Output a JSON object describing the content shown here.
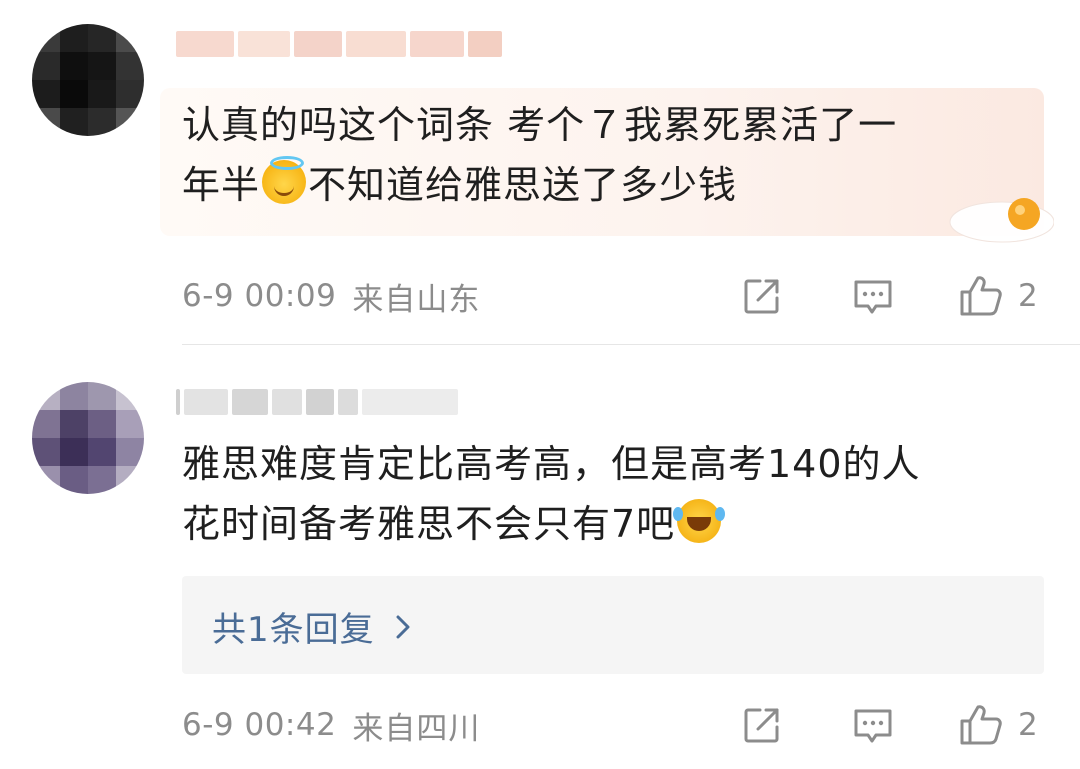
{
  "comments": [
    {
      "text_line1": "认真的吗这个词条 考个７我累死累活了一",
      "text_line2a": "年半",
      "emoji": "smiling-face-with-halo",
      "text_line2b": "不知道给雅思送了多少钱",
      "time": "6-9 00:09",
      "location": "来自山东",
      "likes": "2"
    },
    {
      "text_line1": "雅思难度肯定比高考高，但是高考140的人",
      "text_line2": "花时间备考雅思不会只有7吧",
      "emoji": "rolling-on-floor-laughing",
      "reply_label": "共1条回复",
      "time": "6-9 00:42",
      "location": "来自四川",
      "likes": "2"
    }
  ],
  "colors": {
    "text": "#1f1f1f",
    "meta": "#8c8c8c",
    "reply_link": "#4a6c96",
    "reply_bg": "#f5f5f5",
    "highlight_bg": "#fdf3ee"
  },
  "icons": {
    "share": "share-icon",
    "comment": "comment-icon",
    "like": "thumbs-up-icon",
    "reply_arrow": "chevron-right-icon"
  }
}
